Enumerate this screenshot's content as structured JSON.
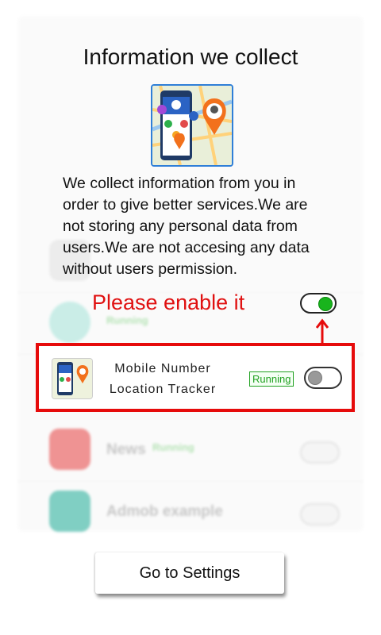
{
  "dialog": {
    "title": "Information we collect",
    "description": "We collect information from you in order to give better services.We are not storing any personal data from users.We are not accesing any data without users permission.",
    "enable_hint": "Please enable it"
  },
  "highlighted_app": {
    "name_line1": "Mobile Number",
    "name_line2": "Location Tracker",
    "status": "Running"
  },
  "background_list": [
    {
      "name": "",
      "status": "Running"
    },
    {
      "name": "News",
      "status": "Running"
    },
    {
      "name": "Admob example",
      "status": ""
    }
  ],
  "settings_button": {
    "label": "Go to Settings"
  },
  "colors": {
    "hint_red": "#e01010",
    "toggle_on_green": "#19b41d",
    "running_green": "#21a121",
    "highlight_border": "#e60b0b"
  }
}
